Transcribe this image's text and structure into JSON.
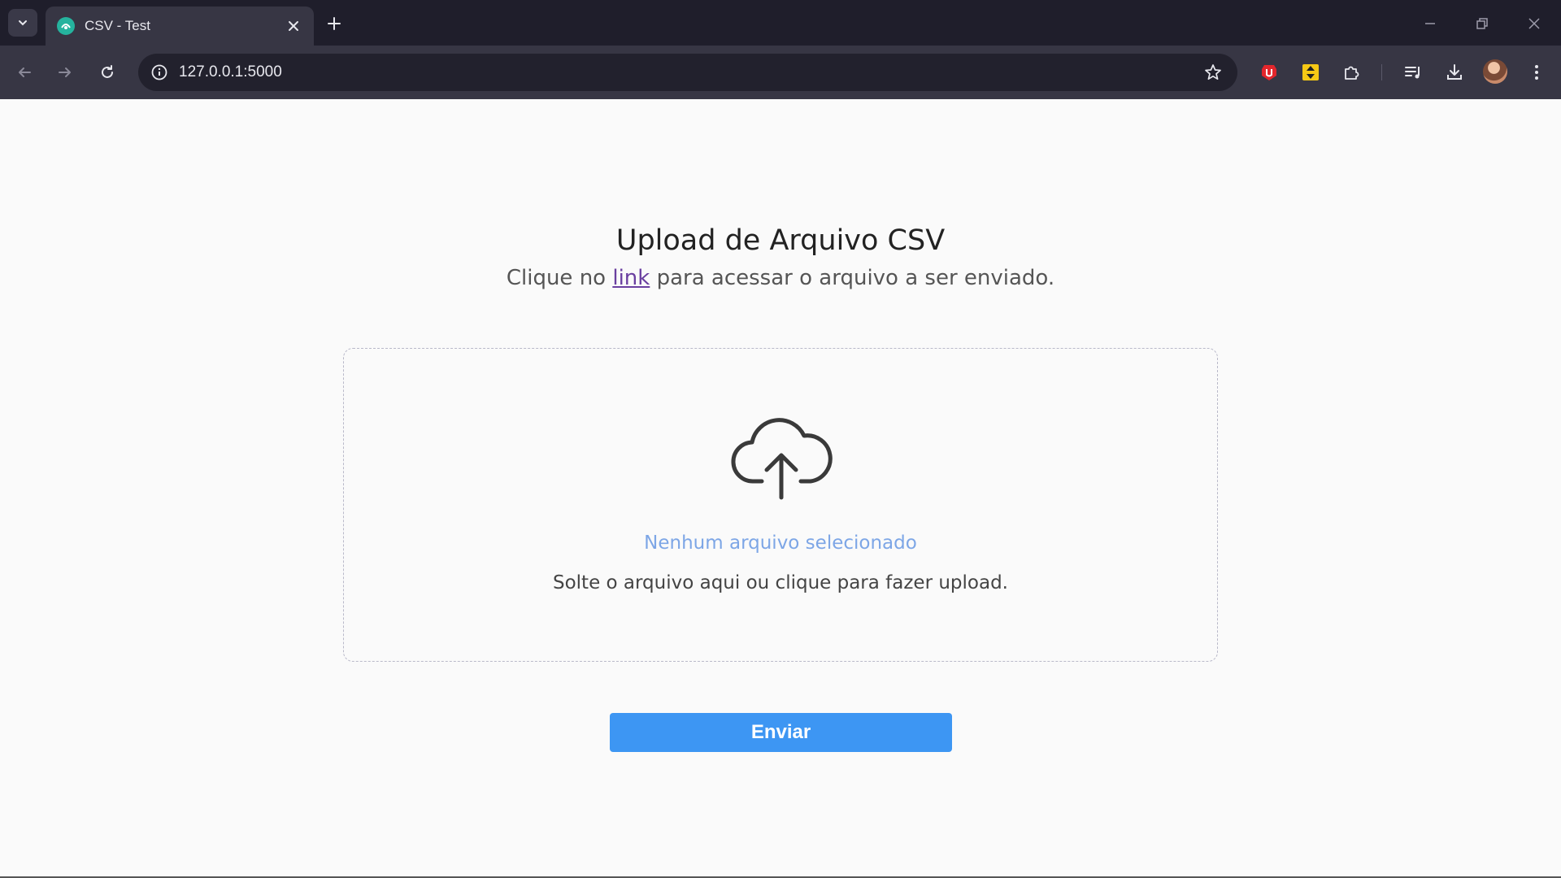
{
  "browser": {
    "tab": {
      "title": "CSV - Test"
    },
    "address_bar": {
      "url": "127.0.0.1:5000"
    }
  },
  "page": {
    "heading": "Upload de Arquivo CSV",
    "subtitle_before": "Clique no ",
    "subtitle_link": "link",
    "subtitle_after": " para acessar o arquivo a ser enviado.",
    "dropzone": {
      "icon": "cloud-upload-icon",
      "status": "Nenhum arquivo selecionado",
      "hint": "Solte o arquivo aqui ou clique para fazer upload."
    },
    "submit_label": "Enviar"
  },
  "colors": {
    "accent_button": "#3d96f3",
    "status_text": "#7da6e6",
    "link": "#6a3fa0",
    "chrome_dark": "#1f1e2b",
    "chrome_toolbar": "#373644"
  }
}
